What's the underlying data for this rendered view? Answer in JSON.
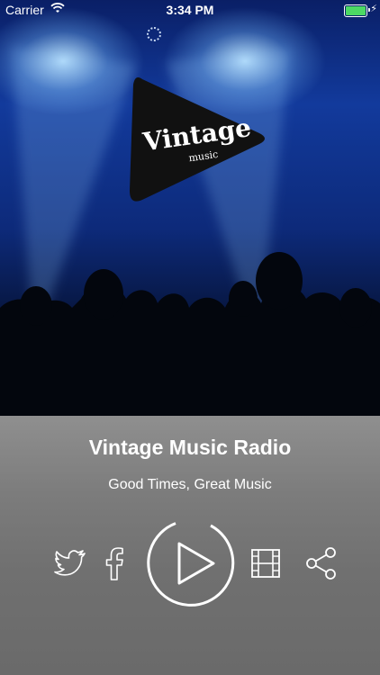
{
  "status_bar": {
    "carrier": "Carrier",
    "time": "3:34 PM",
    "battery_color": "#4cd964"
  },
  "logo": {
    "text_main": "Vintage",
    "text_sub": "music"
  },
  "station": {
    "name": "Vintage Music Radio",
    "tagline": "Good Times, Great Music"
  },
  "controls": {
    "icons": [
      "twitter-icon",
      "facebook-icon",
      "play-icon",
      "film-icon",
      "share-icon"
    ]
  }
}
